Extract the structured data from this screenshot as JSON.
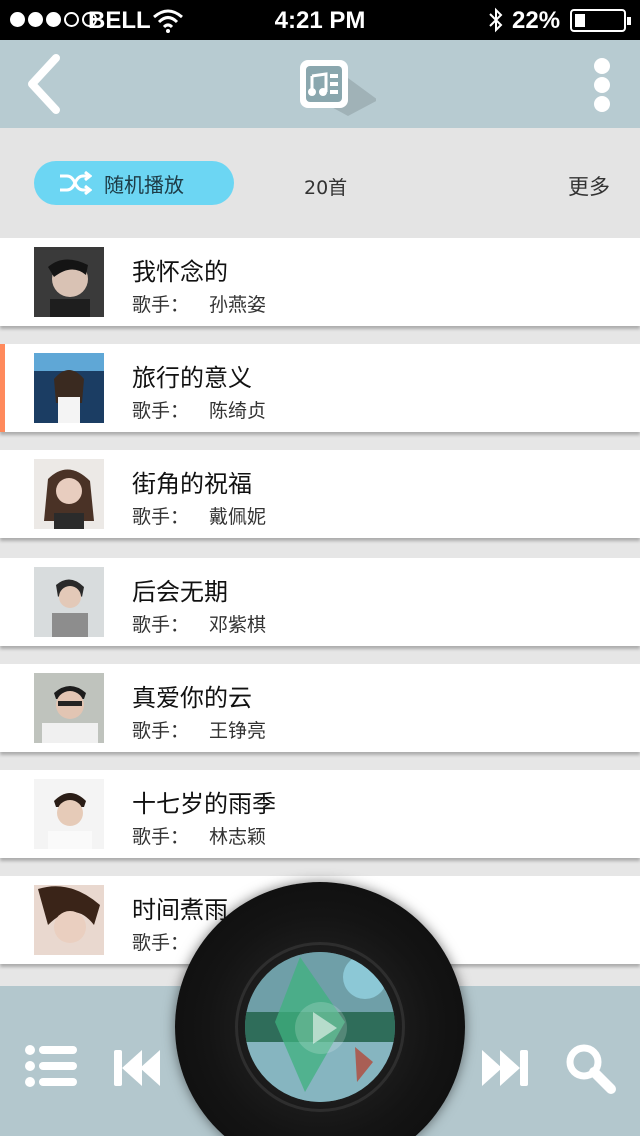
{
  "status_bar": {
    "carrier": "BELL",
    "time": "4:21 PM",
    "battery_percent": "22%",
    "signal_strength": 3,
    "battery_level": 0.22
  },
  "nav": {
    "back_icon": "chevron-left-icon",
    "center_icon": "music-list-icon",
    "menu_icon": "vertical-dots-icon"
  },
  "toolbar": {
    "shuffle_label": "随机播放",
    "count_label": "20首",
    "more_label": "更多"
  },
  "songs": [
    {
      "title": "我怀念的",
      "artist_label": "歌手：",
      "artist": "孙燕姿",
      "active": false
    },
    {
      "title": "旅行的意义",
      "artist_label": "歌手：",
      "artist": "陈绮贞",
      "active": true
    },
    {
      "title": "街角的祝福",
      "artist_label": "歌手：",
      "artist": "戴佩妮",
      "active": false
    },
    {
      "title": "后会无期",
      "artist_label": "歌手：",
      "artist": "邓紫棋",
      "active": false
    },
    {
      "title": "真爱你的云",
      "artist_label": "歌手：",
      "artist": "王铮亮",
      "active": false
    },
    {
      "title": "十七岁的雨季",
      "artist_label": "歌手：",
      "artist": "林志颖",
      "active": false
    },
    {
      "title": "时间煮雨",
      "artist_label": "歌手：",
      "artist": "",
      "active": false
    }
  ],
  "player": {
    "buttons": [
      "playlist-icon",
      "previous-icon",
      "play-icon",
      "next-icon",
      "search-icon"
    ]
  },
  "colors": {
    "nav_bg": "#b7cbd1",
    "shuffle_bg": "#6cd6f3",
    "active_marker": "#ff8a5c",
    "player_bg": "#b3c7cd"
  }
}
